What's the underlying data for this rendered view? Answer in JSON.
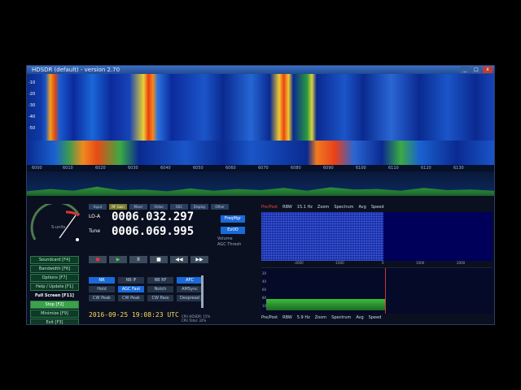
{
  "window": {
    "title": "HDSDR (default) - version 2.70",
    "min": "_",
    "max": "□",
    "close": "x"
  },
  "waterfall": {
    "scale": [
      "-10",
      "-20",
      "-30",
      "-40",
      "-50"
    ]
  },
  "freq_axis": [
    "6000",
    "6010",
    "6020",
    "6030",
    "6040",
    "6050",
    "6060",
    "6070",
    "6080",
    "6090",
    "6100",
    "6110",
    "6120",
    "6130"
  ],
  "sidebar": {
    "buttons": [
      {
        "label": "Soundcard  [F4]",
        "active": false
      },
      {
        "label": "Bandwidth  [F6]",
        "active": false
      },
      {
        "label": "Options  [F7]",
        "active": false
      },
      {
        "label": "Help / Update  [F1]",
        "active": false
      },
      {
        "label": "Full Screen  [F11]",
        "active": false,
        "plain": true
      },
      {
        "label": "Stop  [F2]",
        "active": true
      },
      {
        "label": "Minimize  [F9]",
        "active": false
      },
      {
        "label": "Exit  [F3]",
        "active": false
      }
    ],
    "meter_label": "S-units"
  },
  "top_tabs": [
    "Input",
    "RF Gain",
    "Mixer",
    "Video",
    "OSC",
    "Display",
    "Other"
  ],
  "lo": {
    "label": "LO-A",
    "value": "0006.032.297"
  },
  "tune": {
    "label": "Tune",
    "value": "0006.069.995"
  },
  "buttons": {
    "freqmgr": "FreqMgr",
    "extio": "ExtIO"
  },
  "labels": {
    "volume": "Volume",
    "agc_thresh": "AGC Thresh"
  },
  "transport": {
    "rec": "●",
    "play": "▶",
    "pause": "II",
    "stop": "■",
    "rew": "◀◀",
    "fwd": "▶▶"
  },
  "modes": {
    "row1": [
      "NR",
      "NB IF",
      "NB RF",
      "AFC"
    ],
    "row2": [
      "Hold",
      "AGC Fast",
      "Notch",
      "AMSync"
    ],
    "row3": [
      "CW Peak",
      "CW Peak",
      "CW Pass",
      "Despread"
    ]
  },
  "datetime": "2016-09-25  19:08:23 UTC",
  "cpu": {
    "line1": "CPU HDSDR: 15%",
    "line2": "CPU Total: 32%"
  },
  "rx_panel": {
    "top": {
      "mode": "Pre/Post",
      "rbw_label": "RBW",
      "rbw_value": "15.1 Hz",
      "zoom": "Zoom",
      "spectrum": "Spectrum",
      "avg": "Avg",
      "speed": "Speed"
    },
    "fft_axis": [
      "-2000",
      "-1000",
      "0",
      "1000",
      "2000"
    ],
    "spec_scale": [
      "20",
      "40",
      "60",
      "80",
      "100"
    ],
    "bottom": {
      "mode": "Pre/Post",
      "rbw_label": "RBW",
      "rbw_value": "5.9 Hz",
      "zoom": "Zoom",
      "spectrum": "Spectrum",
      "avg": "Avg",
      "speed": "Speed"
    }
  }
}
